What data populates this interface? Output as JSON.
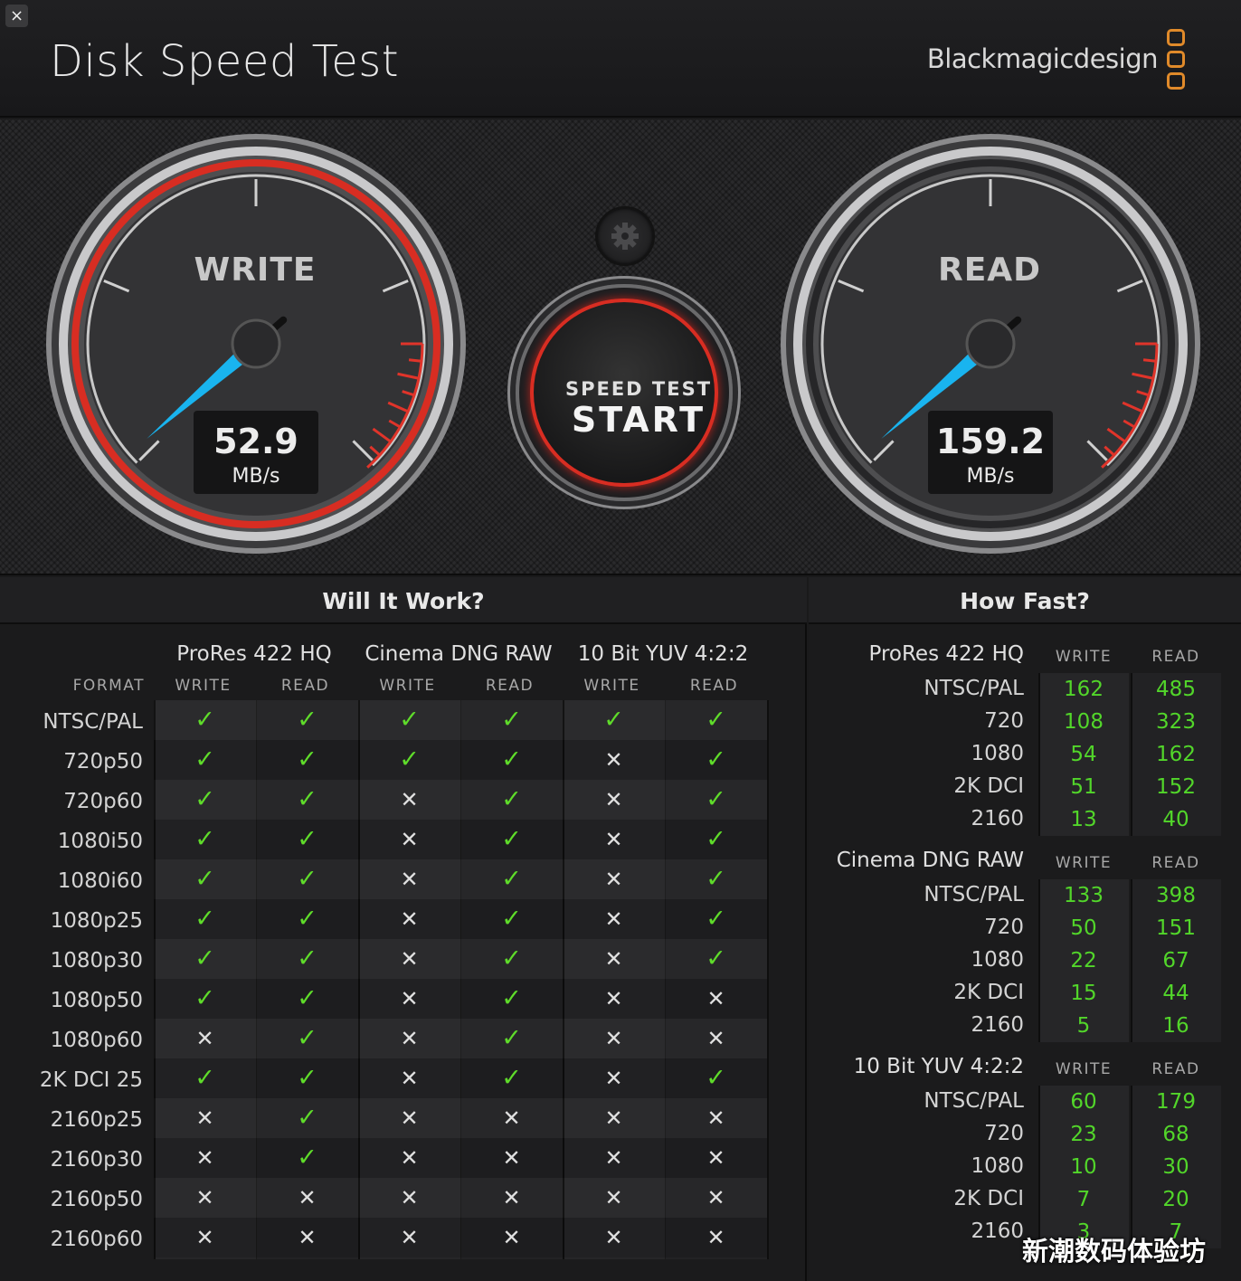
{
  "window": {
    "close_icon": "×"
  },
  "header": {
    "title": "Disk Speed Test",
    "brand": "Blackmagicdesign"
  },
  "gauges": {
    "write": {
      "label": "WRITE",
      "value": "52.9",
      "unit": "MB/s",
      "ring_color": "#d82d22"
    },
    "read": {
      "label": "READ",
      "value": "159.2",
      "unit": "MB/s",
      "ring_color": "#2a2a2c"
    },
    "needle_color": "#19b4ef"
  },
  "start_button": {
    "small_label": "SPEED TEST",
    "big_label": "START"
  },
  "will_it_work": {
    "title": "Will It Work?",
    "format_header": "FORMAT",
    "codecs": [
      "ProRes 422 HQ",
      "Cinema DNG RAW",
      "10 Bit YUV 4:2:2"
    ],
    "write_header": "WRITE",
    "read_header": "READ",
    "rows": [
      {
        "format": "NTSC/PAL",
        "cells": [
          1,
          1,
          1,
          1,
          1,
          1
        ]
      },
      {
        "format": "720p50",
        "cells": [
          1,
          1,
          1,
          1,
          0,
          1
        ]
      },
      {
        "format": "720p60",
        "cells": [
          1,
          1,
          0,
          1,
          0,
          1
        ]
      },
      {
        "format": "1080i50",
        "cells": [
          1,
          1,
          0,
          1,
          0,
          1
        ]
      },
      {
        "format": "1080i60",
        "cells": [
          1,
          1,
          0,
          1,
          0,
          1
        ]
      },
      {
        "format": "1080p25",
        "cells": [
          1,
          1,
          0,
          1,
          0,
          1
        ]
      },
      {
        "format": "1080p30",
        "cells": [
          1,
          1,
          0,
          1,
          0,
          1
        ]
      },
      {
        "format": "1080p50",
        "cells": [
          1,
          1,
          0,
          1,
          0,
          0
        ]
      },
      {
        "format": "1080p60",
        "cells": [
          0,
          1,
          0,
          1,
          0,
          0
        ]
      },
      {
        "format": "2K DCI 25",
        "cells": [
          1,
          1,
          0,
          1,
          0,
          1
        ]
      },
      {
        "format": "2160p25",
        "cells": [
          0,
          1,
          0,
          0,
          0,
          0
        ]
      },
      {
        "format": "2160p30",
        "cells": [
          0,
          1,
          0,
          0,
          0,
          0
        ]
      },
      {
        "format": "2160p50",
        "cells": [
          0,
          0,
          0,
          0,
          0,
          0
        ]
      },
      {
        "format": "2160p60",
        "cells": [
          0,
          0,
          0,
          0,
          0,
          0
        ]
      }
    ],
    "check_glyph": "✓",
    "cross_glyph": "✕"
  },
  "how_fast": {
    "title": "How Fast?",
    "write_header": "WRITE",
    "read_header": "READ",
    "groups": [
      {
        "codec": "ProRes 422 HQ",
        "rows": [
          {
            "label": "NTSC/PAL",
            "write": "162",
            "read": "485"
          },
          {
            "label": "720",
            "write": "108",
            "read": "323"
          },
          {
            "label": "1080",
            "write": "54",
            "read": "162"
          },
          {
            "label": "2K DCI",
            "write": "51",
            "read": "152"
          },
          {
            "label": "2160",
            "write": "13",
            "read": "40"
          }
        ]
      },
      {
        "codec": "Cinema DNG RAW",
        "rows": [
          {
            "label": "NTSC/PAL",
            "write": "133",
            "read": "398"
          },
          {
            "label": "720",
            "write": "50",
            "read": "151"
          },
          {
            "label": "1080",
            "write": "22",
            "read": "67"
          },
          {
            "label": "2K DCI",
            "write": "15",
            "read": "44"
          },
          {
            "label": "2160",
            "write": "5",
            "read": "16"
          }
        ]
      },
      {
        "codec": "10 Bit YUV 4:2:2",
        "rows": [
          {
            "label": "NTSC/PAL",
            "write": "60",
            "read": "179"
          },
          {
            "label": "720",
            "write": "23",
            "read": "68"
          },
          {
            "label": "1080",
            "write": "10",
            "read": "30"
          },
          {
            "label": "2K DCI",
            "write": "7",
            "read": "20"
          },
          {
            "label": "2160",
            "write": "3",
            "read": "7"
          }
        ]
      }
    ]
  },
  "watermark": "新潮数码体验坊"
}
